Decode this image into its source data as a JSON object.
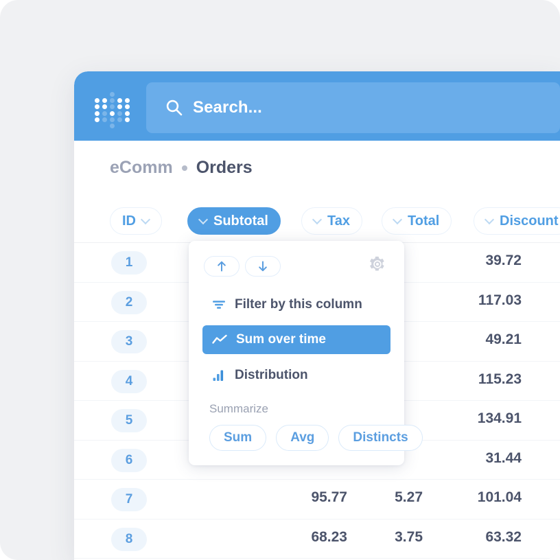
{
  "app": {
    "brand_color": "#509ee3",
    "logo_name": "metabase-dot-logo"
  },
  "topnav": {
    "search": {
      "placeholder": "Search...",
      "value": "",
      "icon": "search-icon"
    }
  },
  "breadcrumb": {
    "database": "eComm",
    "separator": "•",
    "table": "Orders"
  },
  "columns": [
    {
      "label": "ID",
      "active": false,
      "chevron_side": "right"
    },
    {
      "label": "Subtotal",
      "active": true,
      "chevron_side": "left"
    },
    {
      "label": "Tax",
      "active": false,
      "chevron_side": "left"
    },
    {
      "label": "Total",
      "active": false,
      "chevron_side": "left"
    },
    {
      "label": "Discount",
      "active": false,
      "chevron_side": "left"
    }
  ],
  "table": {
    "headers": [
      "ID",
      "Subtotal",
      "Tax",
      "Total",
      "Discount"
    ],
    "rows": [
      {
        "id": "1",
        "subtotal": "",
        "tax": "",
        "total": "39.72"
      },
      {
        "id": "2",
        "subtotal": "",
        "tax": "",
        "total": "117.03"
      },
      {
        "id": "3",
        "subtotal": "",
        "tax": "",
        "total": "49.21"
      },
      {
        "id": "4",
        "subtotal": "",
        "tax": "",
        "total": "115.23"
      },
      {
        "id": "5",
        "subtotal": "",
        "tax": "",
        "total": "134.91"
      },
      {
        "id": "6",
        "subtotal": "",
        "tax": "",
        "total": "31.44"
      },
      {
        "id": "7",
        "subtotal": "95.77",
        "tax": "5.27",
        "total": "101.04"
      },
      {
        "id": "8",
        "subtotal": "68.23",
        "tax": "3.75",
        "total": "63.32"
      }
    ]
  },
  "popup": {
    "sort_ascending_icon": "arrow-up-icon",
    "sort_descending_icon": "arrow-down-icon",
    "settings_icon": "gear-icon",
    "items": [
      {
        "label": "Filter by this column",
        "icon": "filter-icon",
        "selected": false
      },
      {
        "label": "Sum over time",
        "icon": "line-chart-icon",
        "selected": true
      },
      {
        "label": "Distribution",
        "icon": "bar-chart-icon",
        "selected": false
      }
    ],
    "summarize_label": "Summarize",
    "aggregations": [
      "Sum",
      "Avg",
      "Distincts"
    ]
  }
}
